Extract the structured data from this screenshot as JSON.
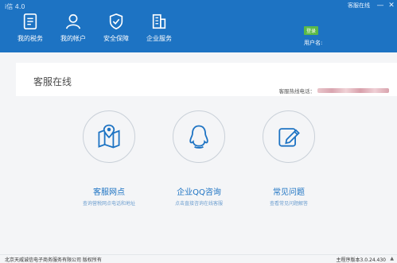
{
  "app": {
    "title": "i信 4.0"
  },
  "window_controls": {
    "service_online": "客服在线",
    "minimize": "—",
    "close": "✕"
  },
  "nav": [
    {
      "label": "我的税务",
      "icon": "document-icon"
    },
    {
      "label": "我的帐户",
      "icon": "user-icon"
    },
    {
      "label": "安全保障",
      "icon": "shield-check-icon"
    },
    {
      "label": "企业服务",
      "icon": "building-icon"
    }
  ],
  "user": {
    "login_label": "登录",
    "user_label": "用户名:"
  },
  "panel": {
    "title": "客服在线",
    "hotline_label": "客服热线电话："
  },
  "cards": [
    {
      "title": "客服网点",
      "desc": "查询营税网点电话和地址",
      "icon": "map-pin-icon"
    },
    {
      "title": "企业QQ咨询",
      "desc": "点击直接咨询在线客服",
      "icon": "qq-penguin-icon"
    },
    {
      "title": "常见问题",
      "desc": "查看常见问题解答",
      "icon": "edit-note-icon"
    }
  ],
  "footer": {
    "copyright": "北京天威诚信电子商务服务有限公司 版权所有",
    "version": "主程序版本3.0.24.430",
    "up_icon": "▲"
  },
  "colors": {
    "brand_blue": "#1d73c3",
    "login_green": "#5ab948",
    "hotline_blur": "#d9a5b0"
  }
}
